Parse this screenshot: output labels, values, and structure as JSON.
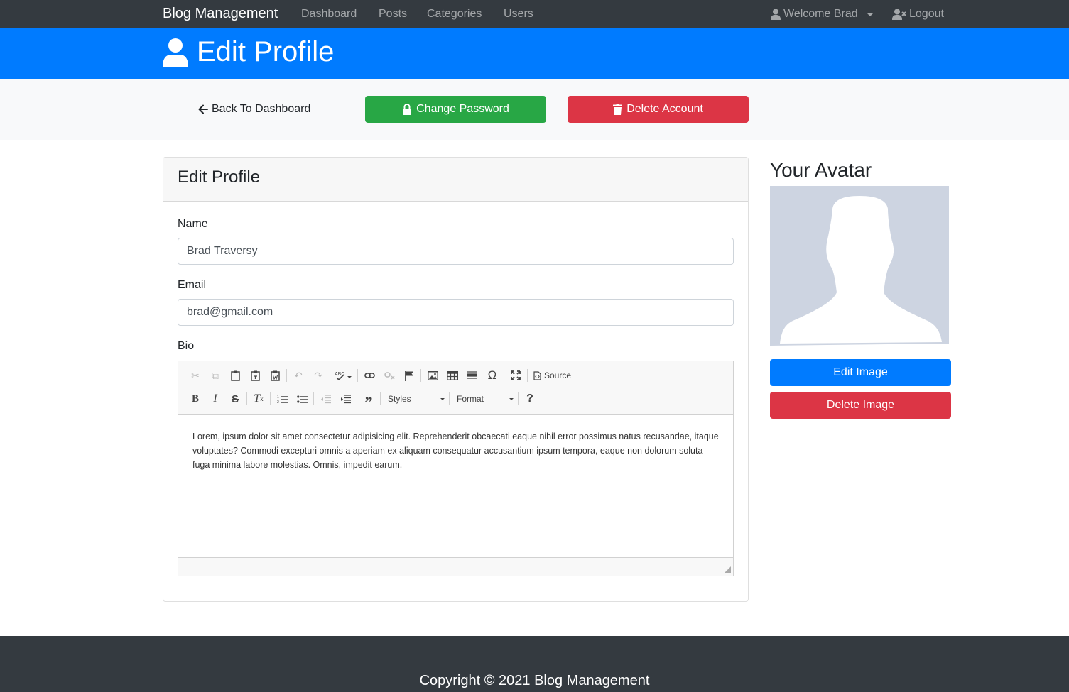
{
  "navbar": {
    "brand": "Blog Management",
    "links": [
      "Dashboard",
      "Posts",
      "Categories",
      "Users"
    ],
    "welcome": "Welcome Brad",
    "logout": "Logout"
  },
  "header": {
    "title": "Edit Profile"
  },
  "actions": {
    "back": "Back To Dashboard",
    "change_password": "Change Password",
    "delete_account": "Delete Account"
  },
  "profile_card": {
    "title": "Edit Profile",
    "name_label": "Name",
    "name_value": "Brad Traversy",
    "email_label": "Email",
    "email_value": "brad@gmail.com",
    "bio_label": "Bio",
    "bio_text": "Lorem, ipsum dolor sit amet consectetur adipisicing elit. Reprehenderit obcaecati eaque nihil error possimus natus recusandae, itaque voluptates? Commodi excepturi omnis a aperiam ex aliquam consequatur accusantium ipsum tempora, eaque non dolorum soluta fuga minima labore molestias. Omnis, impedit earum."
  },
  "editor": {
    "styles_label": "Styles",
    "format_label": "Format",
    "source_label": "Source",
    "row1_icons": [
      "cut-icon",
      "copy-icon",
      "paste-icon",
      "paste-text-icon",
      "paste-word-icon",
      "undo-icon",
      "redo-icon",
      "spellcheck-icon",
      "link-icon",
      "unlink-icon",
      "anchor-icon",
      "image-icon",
      "table-icon",
      "horizontal-line-icon",
      "special-char-icon",
      "maximize-icon",
      "source-icon"
    ],
    "row2_icons": [
      "bold-icon",
      "italic-icon",
      "strike-icon",
      "remove-format-icon",
      "numbered-list-icon",
      "bulleted-list-icon",
      "outdent-icon",
      "indent-icon",
      "blockquote-icon",
      "help-icon"
    ]
  },
  "avatar": {
    "title": "Your Avatar",
    "edit_label": "Edit Image",
    "delete_label": "Delete Image"
  },
  "footer": {
    "text": "Copyright © 2021 Blog Management"
  },
  "colors": {
    "navbar": "#343a40",
    "primary": "#007bff",
    "success": "#28a745",
    "danger": "#dc3545",
    "light": "#f8f9fa"
  }
}
